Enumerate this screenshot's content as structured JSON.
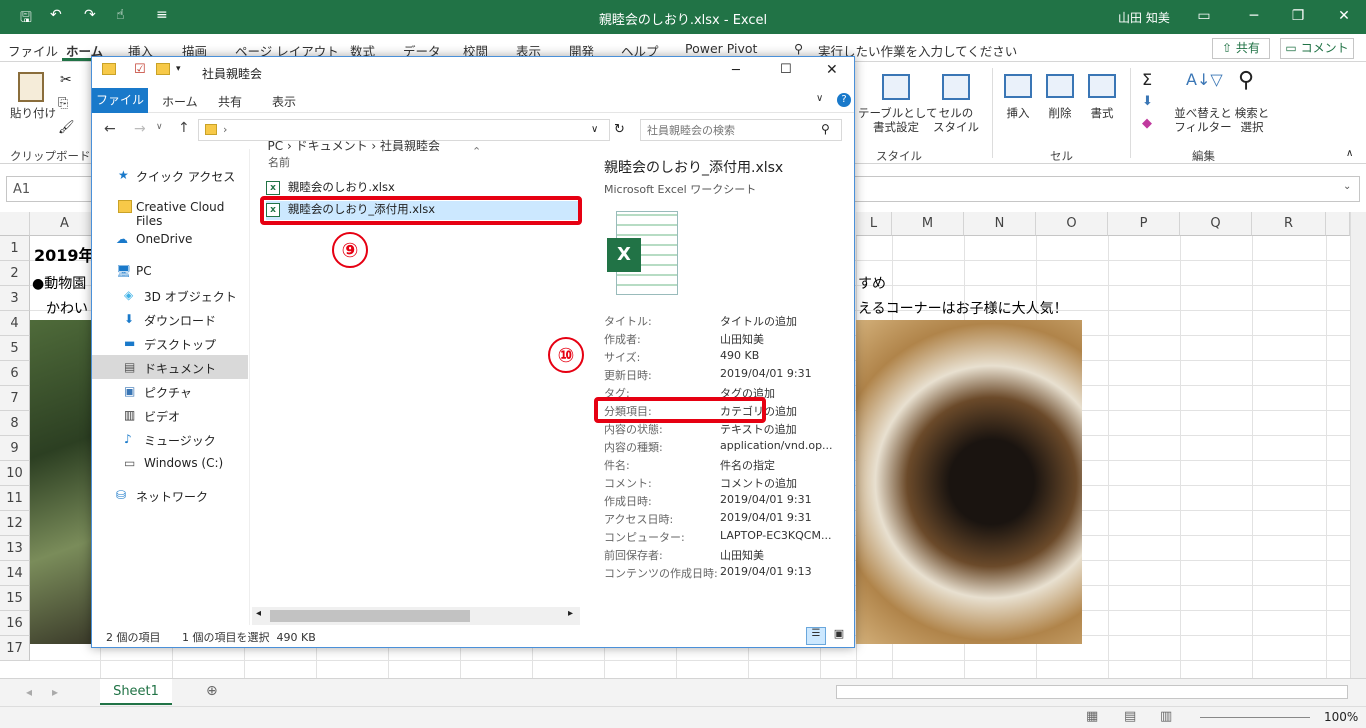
{
  "excel": {
    "doc_title": "親睦会のしおり.xlsx  -  Excel",
    "user": "山田 知美",
    "tabs": [
      "ファイル",
      "ホーム",
      "挿入",
      "描画",
      "ページ レイアウト",
      "数式",
      "データ",
      "校閲",
      "表示",
      "開発",
      "ヘルプ",
      "Power Pivot"
    ],
    "tell_me": "実行したい作業を入力してください",
    "share": "共有",
    "comment": "コメント",
    "ribbon": {
      "paste": "貼り付け",
      "clipboard": "クリップボード",
      "table_format": "テーブルとして\n書式設定",
      "cell_style": "セルの\nスタイル",
      "style_group": "スタイル",
      "insert": "挿入",
      "delete": "削除",
      "format": "書式",
      "cells_group": "セル",
      "sort_filter": "並べ替えと\nフィルター",
      "find_select": "検索と\n選択",
      "editing_group": "編集"
    },
    "name_box": "A1",
    "columns_left": [
      "A"
    ],
    "columns_right": [
      "L",
      "M",
      "N",
      "O",
      "P",
      "Q",
      "R"
    ],
    "rows": [
      "1",
      "2",
      "3",
      "4",
      "5",
      "6",
      "7",
      "8",
      "9",
      "10",
      "11",
      "12",
      "13",
      "14",
      "15",
      "16",
      "17"
    ],
    "cells": {
      "a1": "2019年",
      "a2": "●動物園",
      "a3": "かわい",
      "r2_right": "すめ",
      "r3_right": "えるコーナーはお子様に大人気！"
    },
    "sheet_tab": "Sheet1",
    "zoom": "100%"
  },
  "explorer": {
    "title": "社員親睦会",
    "menu": [
      "ファイル",
      "ホーム",
      "共有",
      "表示"
    ],
    "address": [
      "PC",
      "ドキュメント",
      "社員親睦会"
    ],
    "search_placeholder": "社員親睦会の検索",
    "nav": [
      {
        "label": "クイック アクセス"
      },
      {
        "label": "Creative Cloud Files"
      },
      {
        "label": "OneDrive"
      },
      {
        "label": "PC"
      },
      {
        "label": "3D オブジェクト"
      },
      {
        "label": "ダウンロード"
      },
      {
        "label": "デスクトップ"
      },
      {
        "label": "ドキュメント"
      },
      {
        "label": "ピクチャ"
      },
      {
        "label": "ビデオ"
      },
      {
        "label": "ミュージック"
      },
      {
        "label": "Windows (C:)"
      },
      {
        "label": "ネットワーク"
      }
    ],
    "column_header": "名前",
    "files": [
      "親睦会のしおり.xlsx",
      "親睦会のしおり_添付用.xlsx"
    ],
    "detail": {
      "filename": "親睦会のしおり_添付用.xlsx",
      "filetype": "Microsoft Excel ワークシート",
      "props": [
        {
          "k": "タイトル:",
          "v": "タイトルの追加"
        },
        {
          "k": "作成者:",
          "v": "山田知美"
        },
        {
          "k": "サイズ:",
          "v": "490 KB"
        },
        {
          "k": "更新日時:",
          "v": "2019/04/01 9:31"
        },
        {
          "k": "タグ:",
          "v": "タグの追加"
        },
        {
          "k": "分類項目:",
          "v": "カテゴリの追加"
        },
        {
          "k": "内容の状態:",
          "v": "テキストの追加"
        },
        {
          "k": "内容の種類:",
          "v": "application/vnd.op..."
        },
        {
          "k": "件名:",
          "v": "件名の指定"
        },
        {
          "k": "コメント:",
          "v": "コメントの追加"
        },
        {
          "k": "作成日時:",
          "v": "2019/04/01 9:31"
        },
        {
          "k": "アクセス日時:",
          "v": "2019/04/01 9:31"
        },
        {
          "k": "コンピューター:",
          "v": "LAPTOP-EC3KQCM..."
        },
        {
          "k": "前回保存者:",
          "v": "山田知美"
        },
        {
          "k": "コンテンツの作成日時:",
          "v": "2019/04/01 9:13"
        }
      ]
    },
    "status": {
      "count": "2 個の項目",
      "selected": "1 個の項目を選択  490 KB"
    }
  },
  "annotations": {
    "step9": "⑨",
    "step10": "⑩"
  },
  "colors": {
    "excel_green": "#217346",
    "accent_blue": "#1979ca",
    "highlight_red": "#e60012",
    "selection": "#cce8ff"
  }
}
